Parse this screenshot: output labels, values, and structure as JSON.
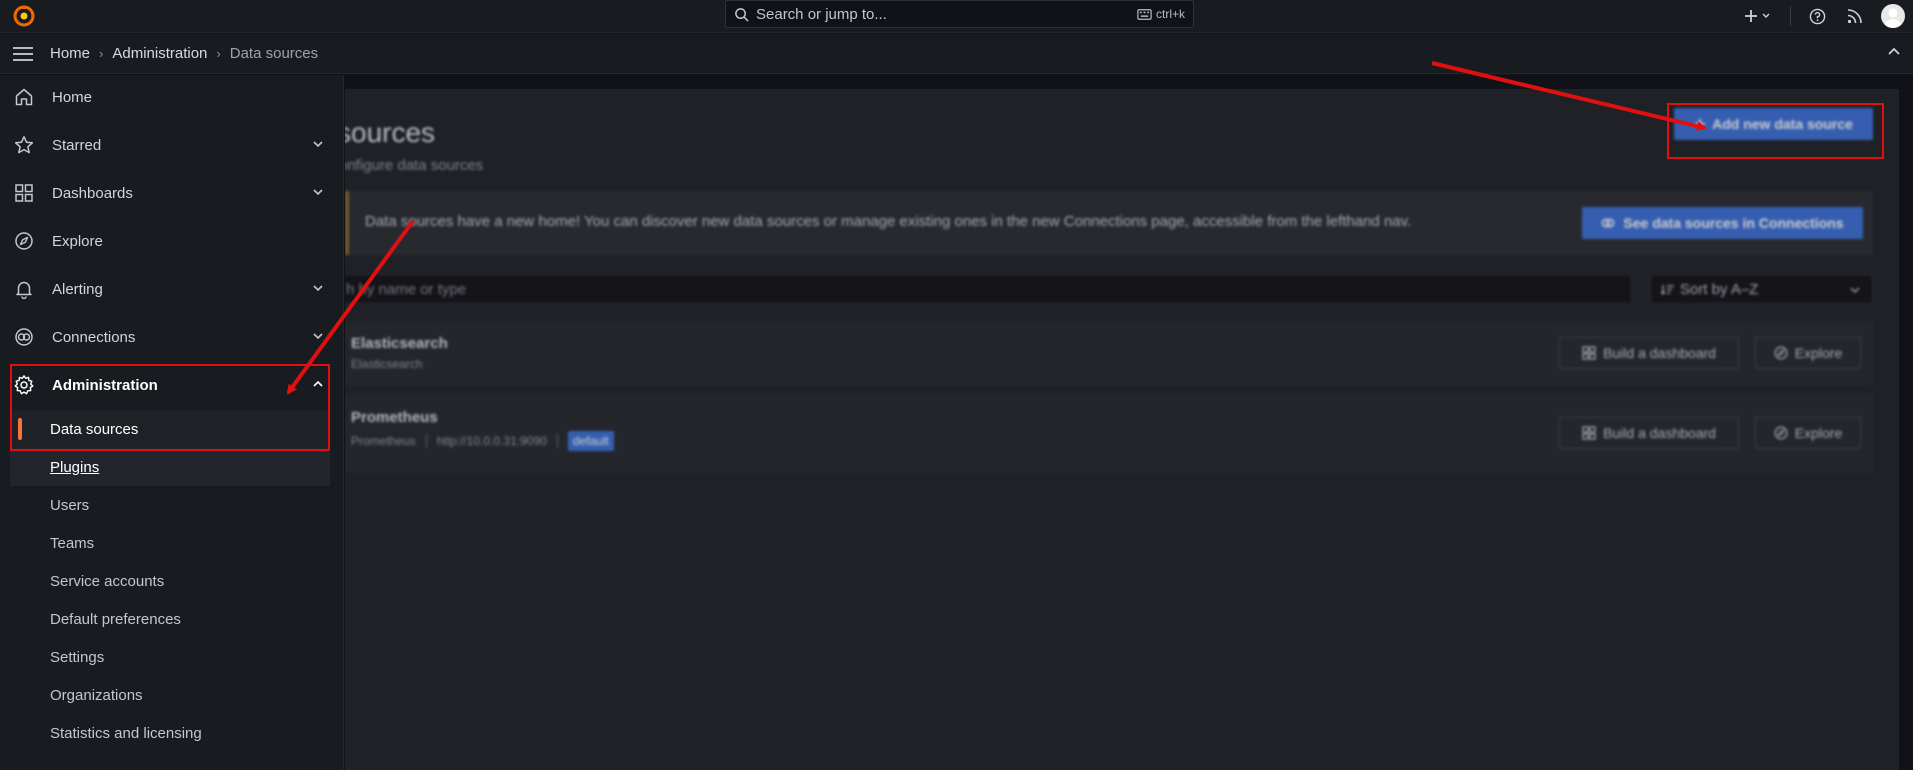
{
  "topbar": {
    "search_placeholder": "Search or jump to...",
    "shortcut": "ctrl+k",
    "icons": [
      "grafana-logo-icon",
      "search-icon",
      "keyboard-icon",
      "plus-icon",
      "help-icon",
      "news-icon",
      "user-avatar"
    ]
  },
  "breadcrumb": {
    "items": [
      "Home",
      "Administration",
      "Data sources"
    ]
  },
  "sidebar": {
    "items": [
      {
        "label": "Home",
        "icon": "home-icon"
      },
      {
        "label": "Starred",
        "icon": "star-icon"
      },
      {
        "label": "Dashboards",
        "icon": "apps-icon"
      },
      {
        "label": "Explore",
        "icon": "compass-icon"
      },
      {
        "label": "Alerting",
        "icon": "bell-icon"
      },
      {
        "label": "Connections",
        "icon": "link-icon"
      },
      {
        "label": "Administration",
        "icon": "cog-icon"
      }
    ],
    "admin_children": [
      "Data sources",
      "Plugins",
      "Users",
      "Teams",
      "Service accounts",
      "Default preferences",
      "Settings",
      "Organizations",
      "Statistics and licensing"
    ]
  },
  "main": {
    "title": "sources",
    "subtitle": "onfigure data sources",
    "add_button": "Add new data source",
    "alert_text": "Data sources have a new home! You can discover new data sources or manage existing ones in the new Connections page, accessible from the lefthand nav.",
    "alert_button": "See data sources in Connections",
    "filter_placeholder": "h by name or type",
    "sort_label": "Sort by A–Z",
    "datasources": [
      {
        "name": "Elasticsearch",
        "type": "Elasticsearch",
        "url": "",
        "badge": ""
      },
      {
        "name": "Prometheus",
        "type": "Prometheus",
        "url": "http://10.0.0.31:9090",
        "badge": "default"
      }
    ],
    "build_dashboard_label": "Build a dashboard",
    "explore_label": "Explore"
  },
  "colors": {
    "accent": "#3d71d9",
    "active_indicator": "#f5733c",
    "annotation": "#e01010"
  }
}
